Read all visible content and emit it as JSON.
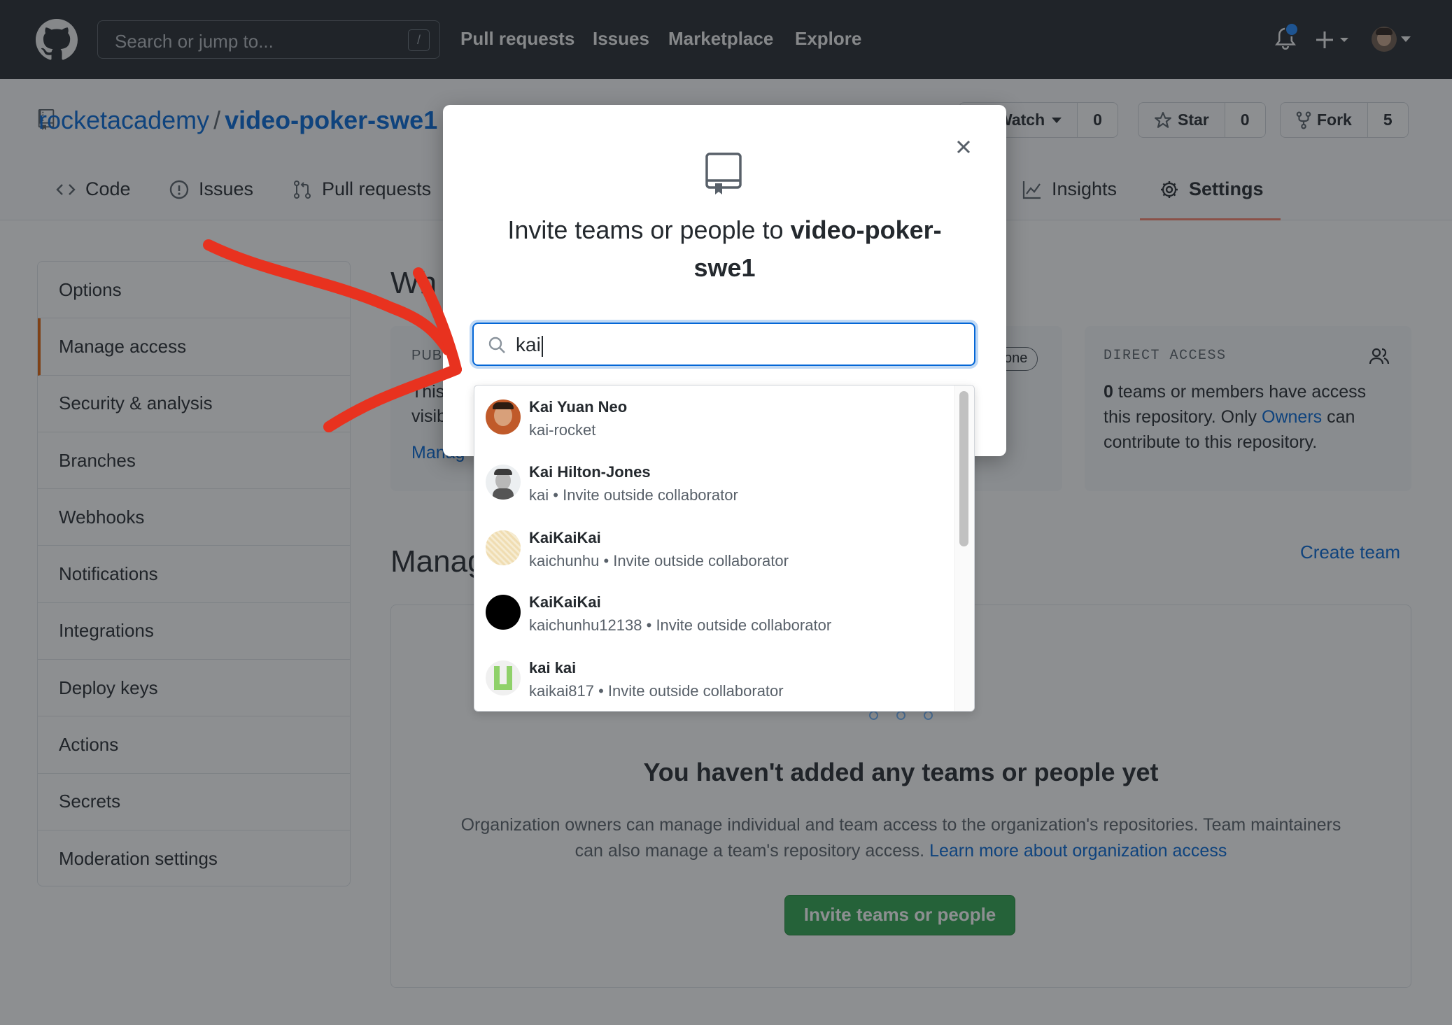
{
  "header": {
    "search_placeholder": "Search or jump to...",
    "search_shortcut": "/",
    "nav": [
      "Pull requests",
      "Issues",
      "Marketplace",
      "Explore"
    ]
  },
  "repo": {
    "owner": "rocketacademy",
    "separator": "/",
    "name": "video-poker-swe1",
    "watch_label": "Watch",
    "watch_count": "0",
    "star_label": "Star",
    "star_count": "0",
    "fork_label": "Fork",
    "fork_count": "5"
  },
  "tabs": [
    {
      "label": "Code",
      "icon": "code-icon"
    },
    {
      "label": "Issues",
      "icon": "issue-icon"
    },
    {
      "label": "Pull requests",
      "icon": "pull-request-icon"
    },
    {
      "label": "Insights",
      "icon": "graph-icon"
    },
    {
      "label": "Settings",
      "icon": "gear-icon",
      "active": true
    }
  ],
  "sidebar": {
    "items": [
      {
        "label": "Options"
      },
      {
        "label": "Manage access",
        "selected": true
      },
      {
        "label": "Security & analysis"
      },
      {
        "label": "Branches"
      },
      {
        "label": "Webhooks"
      },
      {
        "label": "Notifications"
      },
      {
        "label": "Integrations"
      },
      {
        "label": "Deploy keys"
      },
      {
        "label": "Actions"
      },
      {
        "label": "Secrets"
      },
      {
        "label": "Moderation settings"
      }
    ]
  },
  "who_has_access": {
    "heading_partial": "Wh",
    "public_label_partial": "PUBL",
    "visibility_text_partial_1": "This",
    "visibility_text_partial_2": "visib",
    "manage_link_partial": "Manag",
    "base_role_pill_partial": "one",
    "direct_access": {
      "title": "DIRECT ACCESS",
      "count": "0",
      "text_1": "teams or members have access",
      "text_2a": "this repository. Only",
      "owners_link": "Owners",
      "text_2b": "can",
      "text_3": "contribute to this repository."
    }
  },
  "manage_access": {
    "heading_partial": "Manag",
    "create_team": "Create team",
    "empty_title": "You haven't added any teams or people yet",
    "empty_desc_1": "Organization owners can manage individual and team access to the organization's repositories. Team maintainers",
    "empty_desc_2": "can also manage a team's repository access.",
    "learn_more": "Learn more about organization access",
    "invite_button": "Invite teams or people"
  },
  "modal": {
    "title_prefix": "Invite teams or people to",
    "title_repo_line1": "video-poker-",
    "title_repo_line2": "swe1",
    "search_value": "kai",
    "results": [
      {
        "name": "Kai Yuan Neo",
        "login": "kai-rocket",
        "note": ""
      },
      {
        "name": "Kai Hilton-Jones",
        "login": "kai",
        "note": "Invite outside collaborator"
      },
      {
        "name": "KaiKaiKai",
        "login": "kaichunhu",
        "note": "Invite outside collaborator"
      },
      {
        "name": "KaiKaiKai",
        "login": "kaichunhu12138",
        "note": "Invite outside collaborator"
      },
      {
        "name": "kai kai",
        "login": "kaikai817",
        "note": "Invite outside collaborator"
      }
    ],
    "bullet": "•"
  },
  "colors": {
    "header_bg": "#24292e",
    "link": "#0366d6",
    "primary_button": "#2ea44f",
    "active_tab_underline": "#f9826c",
    "annotation_arrow": "#e8321f"
  }
}
